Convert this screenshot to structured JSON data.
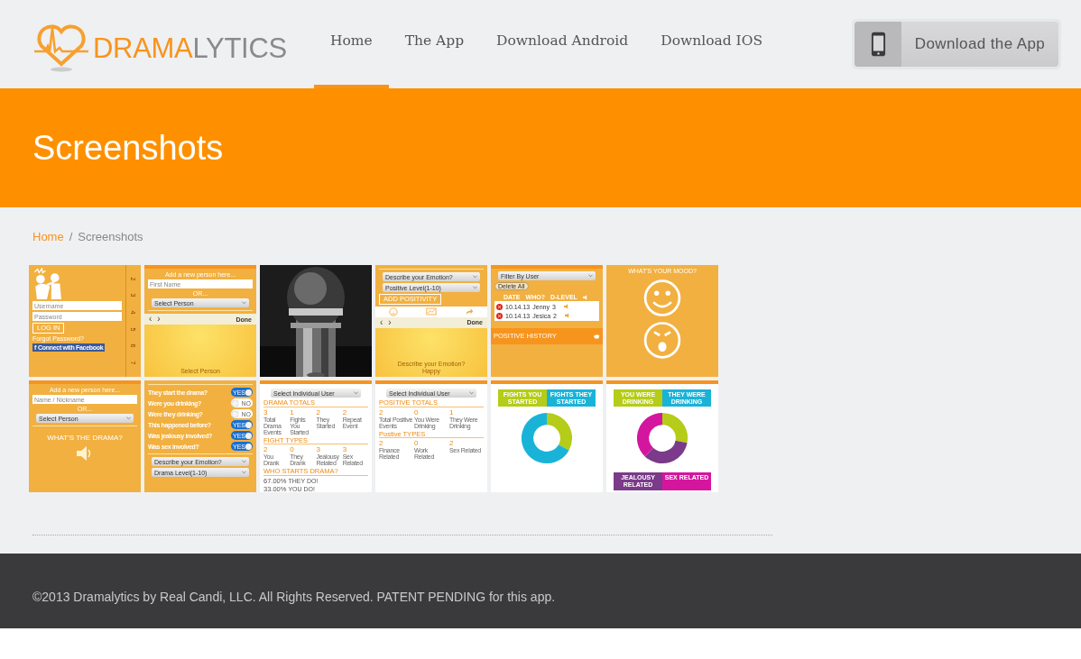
{
  "logo": {
    "first": "DRAMA",
    "second": "LYTICS"
  },
  "nav": [
    {
      "label": "Home",
      "selected": true
    },
    {
      "label": "The App",
      "selected": false
    },
    {
      "label": "Download Android",
      "selected": false
    },
    {
      "label": "Download IOS",
      "selected": false
    }
  ],
  "download_button": "Download the App",
  "banner_title": "Screenshots",
  "breadcrumb": {
    "link": "Home",
    "separator": "/",
    "current": "Screenshots"
  },
  "thumbnails": [
    {
      "kind": "orange",
      "top_bar": false,
      "ruler": [
        "2",
        "3",
        "4",
        "5",
        "6",
        "7"
      ],
      "items": [
        {
          "kind": "figure"
        },
        {
          "kind": "input",
          "placeholder": "Username"
        },
        {
          "kind": "input",
          "placeholder": "Password"
        },
        {
          "kind": "button",
          "text": "LOG IN"
        },
        {
          "kind": "link",
          "text": "Forgot Password?"
        },
        {
          "kind": "facebook",
          "icon": "f",
          "text": "Connect with Facebook"
        }
      ]
    },
    {
      "kind": "orange",
      "top_bar": true,
      "items": [
        {
          "kind": "heading",
          "text": "Add a new person here..."
        },
        {
          "kind": "input",
          "placeholder": "First Name"
        },
        {
          "kind": "heading",
          "text": "OR..."
        },
        {
          "kind": "select",
          "text": "Select Person"
        },
        {
          "kind": "divider"
        },
        {
          "kind": "toolbar",
          "prev": "‹",
          "next": "›",
          "done": "Done"
        },
        {
          "kind": "caption",
          "lines": [
            "Select Person"
          ]
        }
      ]
    },
    {
      "kind": "picture"
    },
    {
      "kind": "orange",
      "top_bar": false,
      "items": [
        {
          "kind": "divider"
        },
        {
          "kind": "select",
          "text": "Describe your Emotion?"
        },
        {
          "kind": "select",
          "text": "Positive Level(1-10)"
        },
        {
          "kind": "button",
          "text": "ADD POSITIVITY"
        },
        {
          "kind": "icon-row"
        },
        {
          "kind": "toolbar",
          "prev": "‹",
          "next": "›",
          "done": "Done"
        },
        {
          "kind": "caption",
          "lines": [
            "Describe your Emotion?",
            "Happy"
          ]
        }
      ]
    },
    {
      "kind": "orange",
      "top_bar": true,
      "items": [
        {
          "kind": "select",
          "text": "Filter By User"
        },
        {
          "kind": "pill",
          "text": "Delete All"
        },
        {
          "kind": "table",
          "headers": [
            "DATE",
            "WHO?",
            "D-LEVEL"
          ],
          "rows": [
            [
              "10.14.13",
              "Jenny",
              "3"
            ],
            [
              "10.14.13",
              "Jesica",
              "2"
            ]
          ]
        },
        {
          "kind": "band",
          "text": "POSITIVE HISTORY"
        }
      ]
    },
    {
      "kind": "orange",
      "top_bar": false,
      "items": [
        {
          "kind": "heading",
          "text": "WHAT'S YOUR MOOD?"
        },
        {
          "kind": "mood-faces"
        }
      ]
    },
    {
      "kind": "orange",
      "top_bar": true,
      "items": [
        {
          "kind": "heading",
          "text": "Add a new person here..."
        },
        {
          "kind": "input",
          "placeholder": "Name / Nickname"
        },
        {
          "kind": "heading",
          "text": "OR..."
        },
        {
          "kind": "select",
          "text": "Select Person"
        },
        {
          "kind": "divider"
        },
        {
          "kind": "title",
          "text": "WHAT'S THE DRAMA?"
        },
        {
          "kind": "speaker"
        }
      ]
    },
    {
      "kind": "orange",
      "top_bar": false,
      "items": [
        {
          "kind": "divider"
        },
        {
          "kind": "toggle",
          "label": "They start the drama?",
          "state": "YES",
          "on": true
        },
        {
          "kind": "toggle",
          "label": "Were you drinking?",
          "state": "NO",
          "on": false
        },
        {
          "kind": "toggle",
          "label": "Were they drinking?",
          "state": "NO",
          "on": false
        },
        {
          "kind": "toggle",
          "label": "This happened before?",
          "state": "YES",
          "on": true
        },
        {
          "kind": "toggle",
          "label": "Was jealousy involved?",
          "state": "YES",
          "on": true
        },
        {
          "kind": "toggle",
          "label": "Was sex involved?",
          "state": "YES",
          "on": true
        },
        {
          "kind": "divider"
        },
        {
          "kind": "select",
          "text": "Describe your Emotion?"
        },
        {
          "kind": "select",
          "text": "Drama Level(1-10)"
        }
      ]
    },
    {
      "kind": "white",
      "top_bar": true,
      "items": [
        {
          "kind": "select",
          "text": "Select Individual User"
        },
        {
          "kind": "section",
          "text": "DRAMA TOTALS"
        },
        {
          "kind": "stats",
          "stats": [
            {
              "value": "3",
              "label": "Total Drama Events"
            },
            {
              "value": "1",
              "label": "Fights You Started"
            },
            {
              "value": "2",
              "label": "They Started"
            },
            {
              "value": "2",
              "label": "Repeat Event"
            }
          ]
        },
        {
          "kind": "section",
          "text": "FIGHT TYPES"
        },
        {
          "kind": "stats",
          "stats": [
            {
              "value": "2",
              "label": "You Drank"
            },
            {
              "value": "0",
              "label": "They Drank"
            },
            {
              "value": "3",
              "label": "Jealousy Related"
            },
            {
              "value": "3",
              "label": "Sex Related"
            }
          ]
        },
        {
          "kind": "section",
          "text": "WHO STARTS DRAMA?"
        },
        {
          "kind": "stat-line",
          "value": "67.00%",
          "text": "THEY DO!"
        },
        {
          "kind": "stat-line",
          "value": "33.00%",
          "text": "YOU DO!"
        }
      ]
    },
    {
      "kind": "white",
      "top_bar": true,
      "items": [
        {
          "kind": "select",
          "text": "Select Individual User"
        },
        {
          "kind": "section",
          "text": "POSITIVE TOTALS"
        },
        {
          "kind": "stats",
          "stats": [
            {
              "value": "2",
              "label": "Total Positive Events"
            },
            {
              "value": "0",
              "label": "You Were Drinking"
            },
            {
              "value": "1",
              "label": "They Were Drinking"
            }
          ]
        },
        {
          "kind": "section",
          "text": "Postive TYPES"
        },
        {
          "kind": "stats",
          "stats": [
            {
              "value": "2",
              "label": "Finance Related"
            },
            {
              "value": "0",
              "label": "Work Related"
            },
            {
              "value": "2",
              "label": "Sex Related"
            }
          ]
        }
      ]
    },
    {
      "kind": "white",
      "top_bar": true,
      "items": [
        {
          "kind": "legend",
          "cells": [
            {
              "text": "FIGHTS YOU STARTED",
              "color": "#b5cc18"
            },
            {
              "text": "FIGHTS THEY STARTED",
              "color": "#1ab3d8"
            }
          ]
        },
        {
          "kind": "donut",
          "segments": [
            {
              "color": "#b5cc18"
            },
            {
              "color": "#1ab3d8"
            }
          ]
        }
      ]
    },
    {
      "kind": "white",
      "top_bar": true,
      "items": [
        {
          "kind": "legend",
          "cells": [
            {
              "text": "YOU WERE DRINKING",
              "color": "#b5cc18"
            },
            {
              "text": "THEY WERE DRINKING",
              "color": "#1ab3d8"
            }
          ]
        },
        {
          "kind": "donut",
          "segments": [
            {
              "color": "#b5cc18"
            },
            {
              "color": "#7b3a8a"
            },
            {
              "color": "#d4169e"
            }
          ]
        },
        {
          "kind": "legend",
          "cells": [
            {
              "text": "JEALOUSY RELATED",
              "color": "#7b3a8a"
            },
            {
              "text": "SEX RELATED",
              "color": "#d4169e"
            }
          ]
        }
      ]
    }
  ],
  "footer": "©2013 Dramalytics by Real Candi, LLC. All Rights Reserved. PATENT PENDING for this app."
}
